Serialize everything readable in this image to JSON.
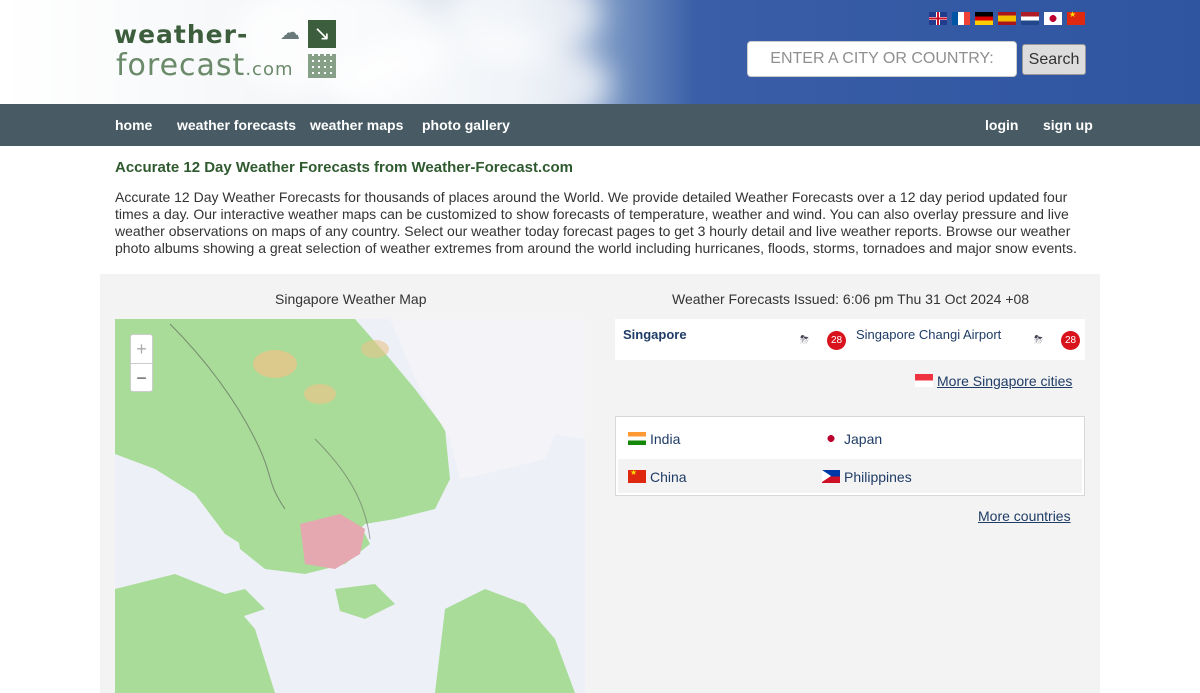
{
  "header": {
    "logo_top": "weather-",
    "logo_bottom": "forecast",
    "logo_dotcom": ".com",
    "flags": [
      "uk-flag",
      "france-flag",
      "germany-flag",
      "spain-flag",
      "netherlands-flag",
      "japan-flag",
      "china-flag"
    ],
    "search_placeholder": "ENTER A CITY OR COUNTRY:",
    "search_button": "Search"
  },
  "nav": {
    "left": [
      "home",
      "weather forecasts",
      "weather maps",
      "photo gallery"
    ],
    "right": [
      "login",
      "sign up"
    ]
  },
  "intro": {
    "title": "Accurate 12 Day Weather Forecasts from Weather-Forecast.com",
    "text": "Accurate 12 Day Weather Forecasts for thousands of places around the World. We provide detailed Weather Forecasts over a 12 day period updated four times a day. Our interactive weather maps can be customized to show forecasts of temperature, weather and wind. You can also overlay pressure and live weather observations on maps of any country. Select our weather today forecast pages to get 3 hourly detail and live weather reports. Browse our weather photo albums showing a great selection of weather extremes from around the world including hurricanes, floods, storms, tornadoes and major snow events."
  },
  "map": {
    "title": "Singapore Weather Map",
    "zoom_in": "+",
    "zoom_out": "−"
  },
  "forecasts": {
    "issued": "Weather Forecasts Issued: 6:06 pm Thu 31 Oct 2024 +08",
    "cities": [
      {
        "name": "Singapore",
        "temp": "28"
      },
      {
        "name": "Singapore Changi Airport",
        "temp": "28"
      }
    ],
    "more_cities": "More Singapore cities",
    "countries": [
      "India",
      "Japan",
      "China",
      "Philippines"
    ],
    "more_countries": "More countries"
  },
  "colors": {
    "nav_bg": "#485b64",
    "title_green": "#2f5a2f",
    "link_blue": "#1f3c66",
    "temp_badge": "#d9131c"
  }
}
